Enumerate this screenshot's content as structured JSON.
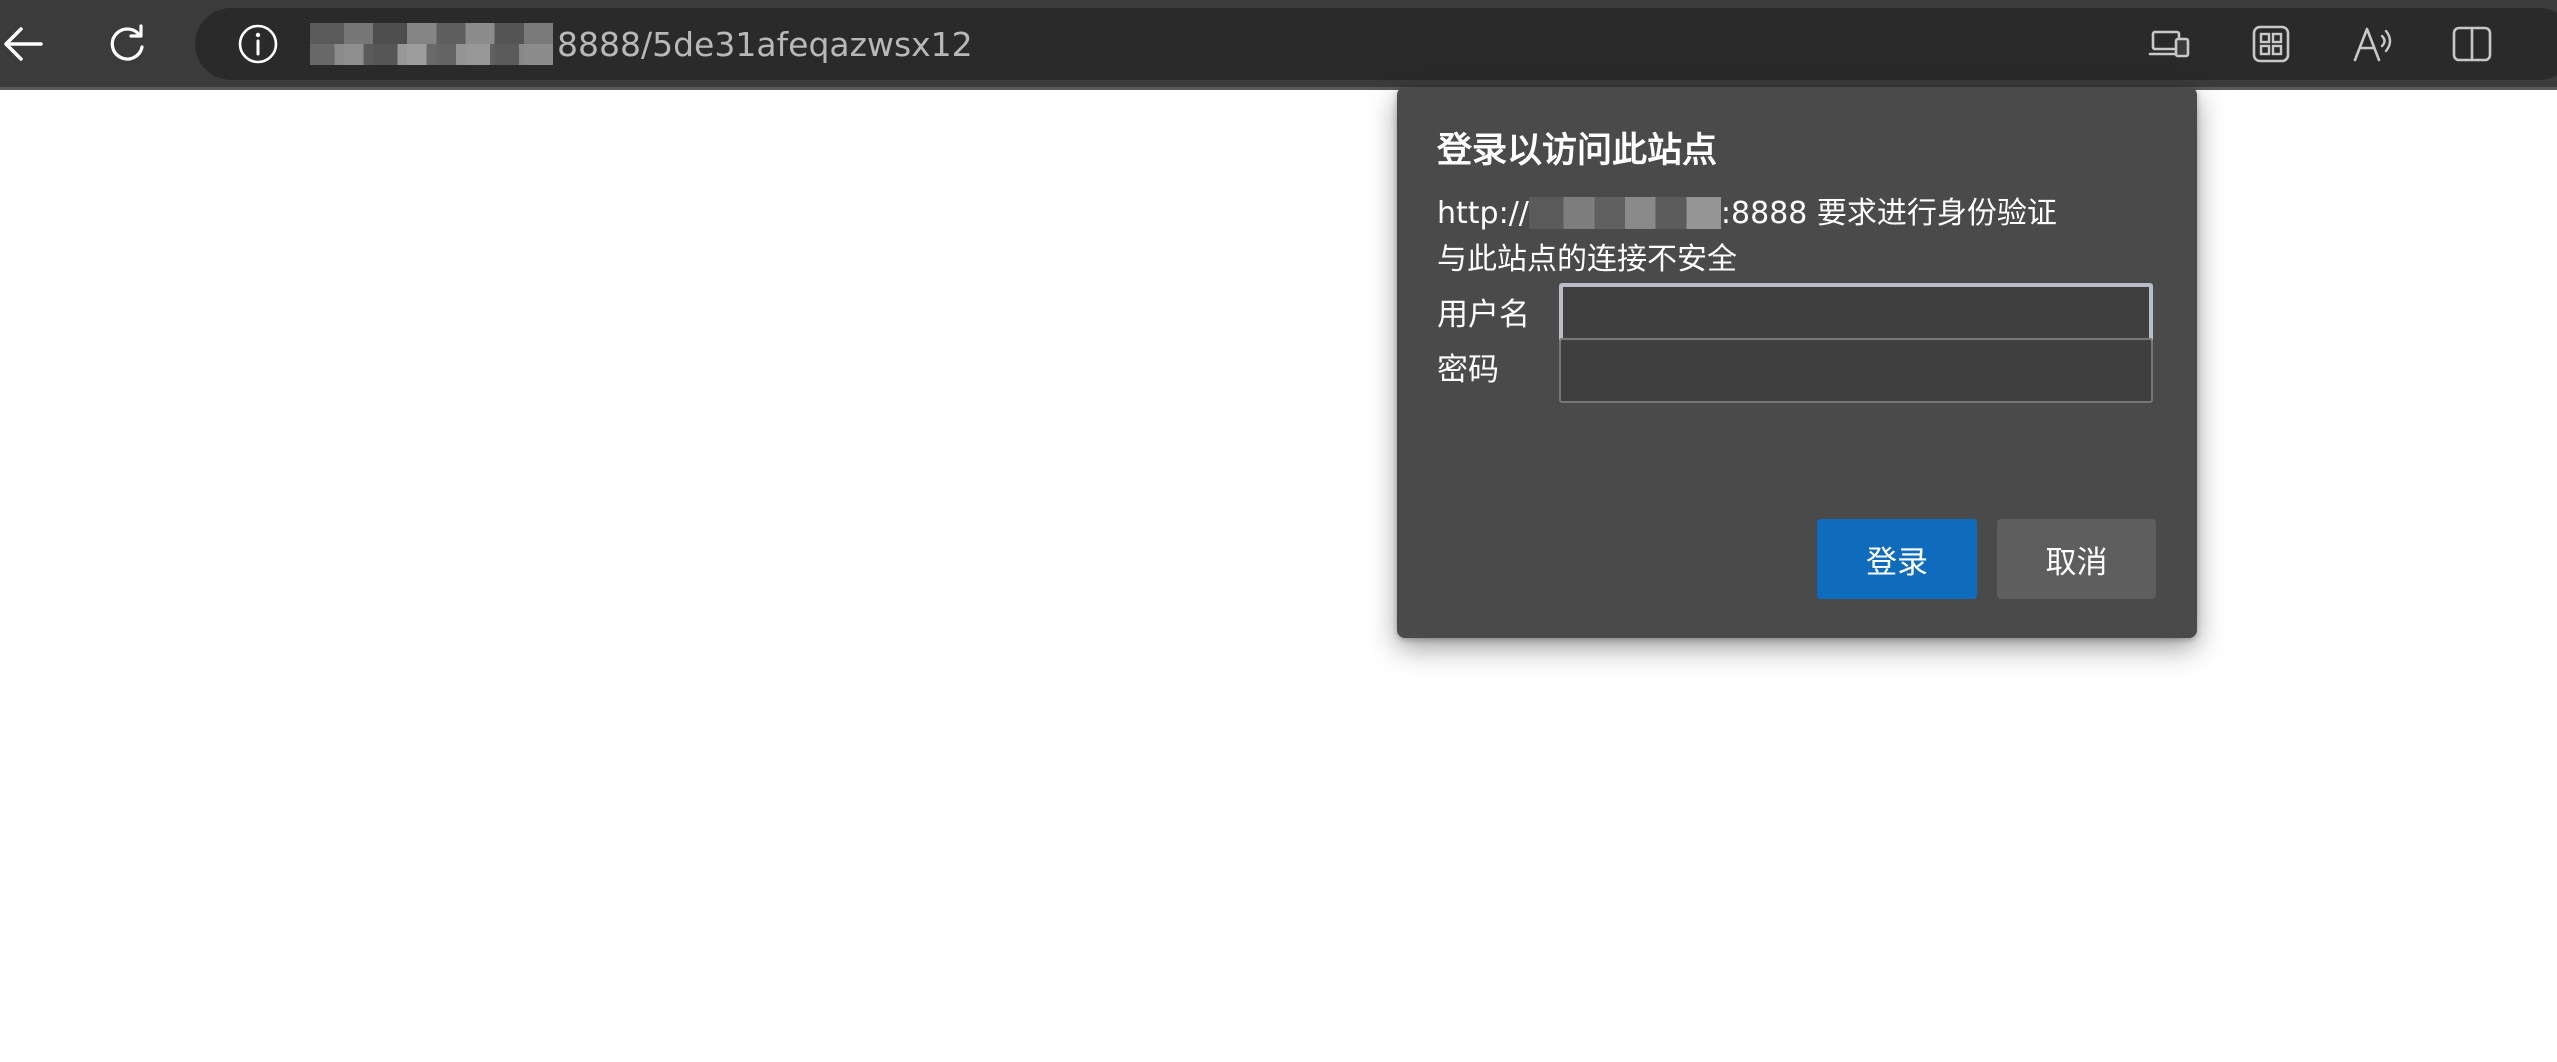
{
  "toolbar": {
    "back_icon": "back-arrow-icon",
    "refresh_icon": "refresh-icon",
    "address": {
      "info_icon": "info-icon",
      "url_visible_suffix": "8888/5de31afeqazwsx12"
    },
    "right_icons": [
      "device-cast-icon",
      "apps-icon",
      "read-aloud-icon",
      "split-screen-icon"
    ]
  },
  "dialog": {
    "title": "登录以访问此站点",
    "message_prefix": "http://",
    "message_suffix": ":8888 要求进行身份验证",
    "warning": "与此站点的连接不安全",
    "username_label": "用户名",
    "username_value": "",
    "password_label": "密码",
    "password_value": "",
    "login_button": "登录",
    "cancel_button": "取消"
  },
  "colors": {
    "toolbar_bg": "#3b3b3b",
    "address_bg": "#2a2a2a",
    "dialog_bg": "#4a4a4a",
    "primary": "#0f6cbd",
    "secondary": "#5e5e5e"
  }
}
